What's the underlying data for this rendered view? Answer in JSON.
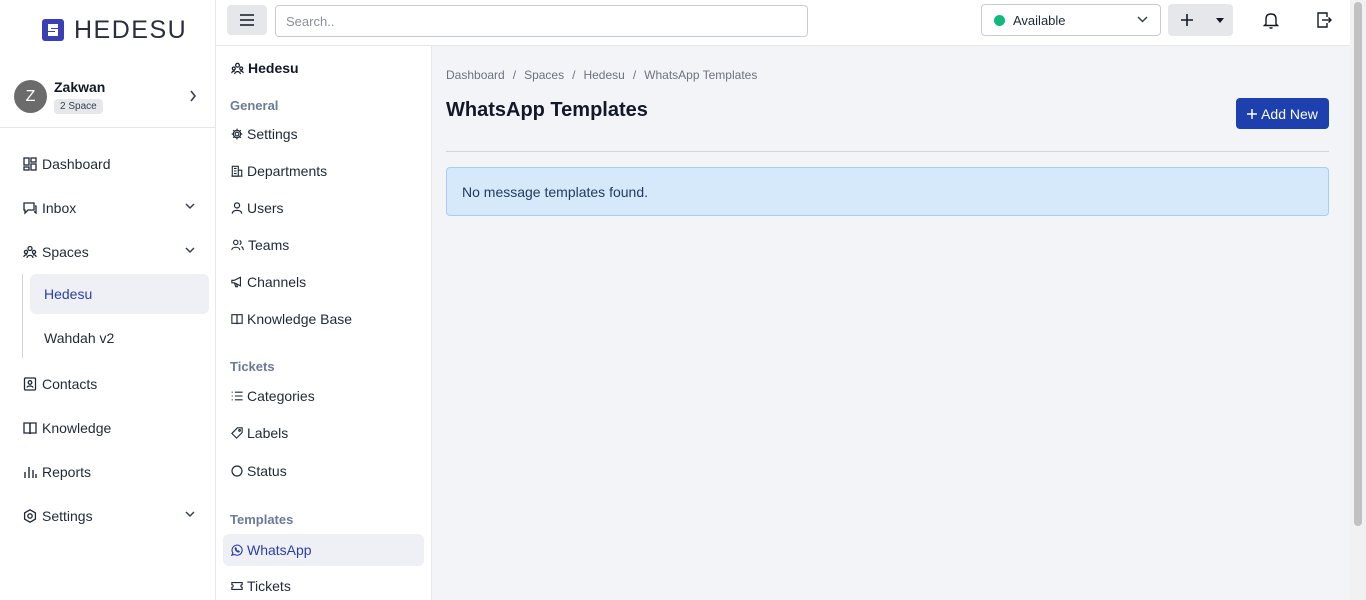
{
  "brand": {
    "name": "HEDESU",
    "accent": "#3b3fb6"
  },
  "user": {
    "initial": "Z",
    "name": "Zakwan",
    "badge": "2 Space"
  },
  "sidebar": {
    "items": [
      {
        "label": "Dashboard",
        "icon": "dashboard-icon"
      },
      {
        "label": "Inbox",
        "icon": "inbox-icon"
      },
      {
        "label": "Spaces",
        "icon": "spaces-icon"
      },
      {
        "label": "Contacts",
        "icon": "contacts-icon"
      },
      {
        "label": "Knowledge",
        "icon": "book-icon"
      },
      {
        "label": "Reports",
        "icon": "chart-icon"
      },
      {
        "label": "Settings",
        "icon": "gear-icon"
      }
    ],
    "spaces": [
      {
        "label": "Hedesu",
        "active": true
      },
      {
        "label": "Wahdah v2",
        "active": false
      }
    ]
  },
  "space_menu": {
    "title": "Hedesu",
    "general": {
      "label": "General",
      "items": [
        "Settings",
        "Departments",
        "Users",
        "Teams",
        "Channels",
        "Knowledge Base"
      ]
    },
    "tickets": {
      "label": "Tickets",
      "items": [
        "Categories",
        "Labels",
        "Status"
      ]
    },
    "templates": {
      "label": "Templates",
      "items": [
        "WhatsApp",
        "Tickets"
      ]
    }
  },
  "topbar": {
    "search_placeholder": "Search..",
    "status": {
      "label": "Available",
      "color": "#10b981"
    }
  },
  "main": {
    "breadcrumb": [
      "Dashboard",
      "Spaces",
      "Hedesu",
      "WhatsApp Templates"
    ],
    "breadcrumb_sep": "/",
    "title": "WhatsApp Templates",
    "add_button": "Add New",
    "empty_message": "No message templates found."
  }
}
